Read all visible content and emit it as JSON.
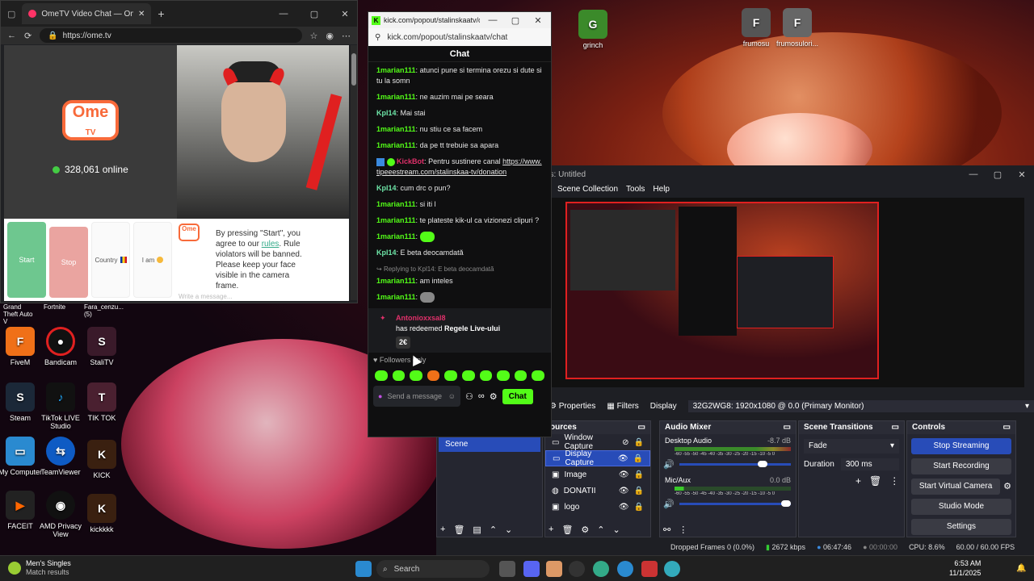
{
  "browser": {
    "tab_title": "OmeTV Video Chat — Omeg",
    "url": "https://ome.tv",
    "logo_text": "Ome",
    "logo_sub": "TV",
    "online_count": "328,061 online",
    "buttons": {
      "start": "Start",
      "stop": "Stop",
      "country": "Country",
      "iam": "I am"
    },
    "notice_parts": [
      "By pressing \"Start\", you agree to our ",
      "rules",
      ". Rule violators will be banned. Please keep your face visible in the camera frame."
    ],
    "message_placeholder": "Write a message..."
  },
  "kick": {
    "window_title": "kick.com/popout/stalinskaatv/c...",
    "url": "kick.com/popout/stalinskaatv/chat",
    "header": "Chat",
    "messages": [
      {
        "user": "1marian111",
        "text": "atunci pune si termina orezu si dute si tu la somn"
      },
      {
        "user": "1marian111",
        "text": "ne auzim mai pe seara"
      },
      {
        "user": "Kpl14",
        "text": "Mai stai"
      },
      {
        "user": "1marian111",
        "text": "nu stiu ce sa facem"
      },
      {
        "user": "1marian111",
        "text": "da pe tt trebuie sa apara"
      },
      {
        "user": "KickBot",
        "text": "Pentru sustinere canal",
        "link": "https://www.tipeeestream.com/stalinskaa-tv/donation"
      },
      {
        "user": "Kpl14",
        "text": "cum drc o pun?"
      },
      {
        "user": "1marian111",
        "text": "si iti l"
      },
      {
        "user": "1marian111",
        "text": "te plateste kik-ul ca vizionezi clipuri ?"
      },
      {
        "user": "1marian111",
        "text": ""
      },
      {
        "user": "Kpl14",
        "text": "E beta deocamdată"
      }
    ],
    "reply_note": "Replying to Kpl14: E beta deocamdată",
    "reply_msg": {
      "user": "1marian111",
      "text": "am inteles"
    },
    "redeem": {
      "user": "Antonioxxsal8",
      "text_pre": "has redeemed ",
      "reward": "Regele Live-ului",
      "cost": "2€"
    },
    "followers_only": "Followers only",
    "send_placeholder": "Send a message",
    "chat_button": "Chat"
  },
  "obs": {
    "title": "es: Untitled",
    "menu": [
      "Scene Collection",
      "Tools",
      "Help"
    ],
    "toolbar": {
      "properties": "Properties",
      "filters": "Filters",
      "display_label": "Display",
      "display_value": "32G2WG8: 1920x1080 @ 0.0 (Primary Monitor)"
    },
    "scenes_panel": {
      "scene": "Scene"
    },
    "sources_panel": {
      "title": "ources",
      "items": [
        "Window Capture",
        "Display Capture",
        "Image",
        "DONATII",
        "logo"
      ]
    },
    "audio_mixer": {
      "title": "Audio Mixer",
      "tracks": [
        {
          "name": "Desktop Audio",
          "db": "-8.7 dB"
        },
        {
          "name": "Mic/Aux",
          "db": "0.0 dB"
        }
      ],
      "scale": "-60 -55 -50 -45 -40 -35 -30 -25 -20 -15 -10 -5 0"
    },
    "transitions": {
      "title": "Scene Transitions",
      "type": "Fade",
      "duration_label": "Duration",
      "duration_value": "300 ms"
    },
    "controls": {
      "title": "Controls",
      "stop_streaming": "Stop Streaming",
      "start_recording": "Start Recording",
      "virtual_camera": "Start Virtual Camera",
      "studio_mode": "Studio Mode",
      "settings": "Settings"
    },
    "status": {
      "dropped": "Dropped Frames 0 (0.0%)",
      "kbps": "2672 kbps",
      "live_time": "06:47:46",
      "rec_time": "00:00:00",
      "cpu": "CPU: 8.6%",
      "fps": "60.00 / 60.00 FPS"
    }
  },
  "desktop": {
    "icons": [
      "grinch",
      "frumosu",
      "frumosulori...",
      "FiveM",
      "Bandicam",
      "StaliTV",
      "Steam",
      "TikTok LIVE Studio",
      "TIK TOK",
      "My Computer",
      "TeamViewer",
      "KICK",
      "FACEIT",
      "AMD Privacy View",
      "kickkkk"
    ],
    "partial_labels": [
      "Grand Theft Auto V",
      "Fortnite",
      "Fara_cenzu... (5)"
    ]
  },
  "taskbar": {
    "widget_title": "Men's Singles",
    "widget_sub": "Match results",
    "search": "Search",
    "time": "6:53 AM",
    "date": "11/1/2025"
  }
}
